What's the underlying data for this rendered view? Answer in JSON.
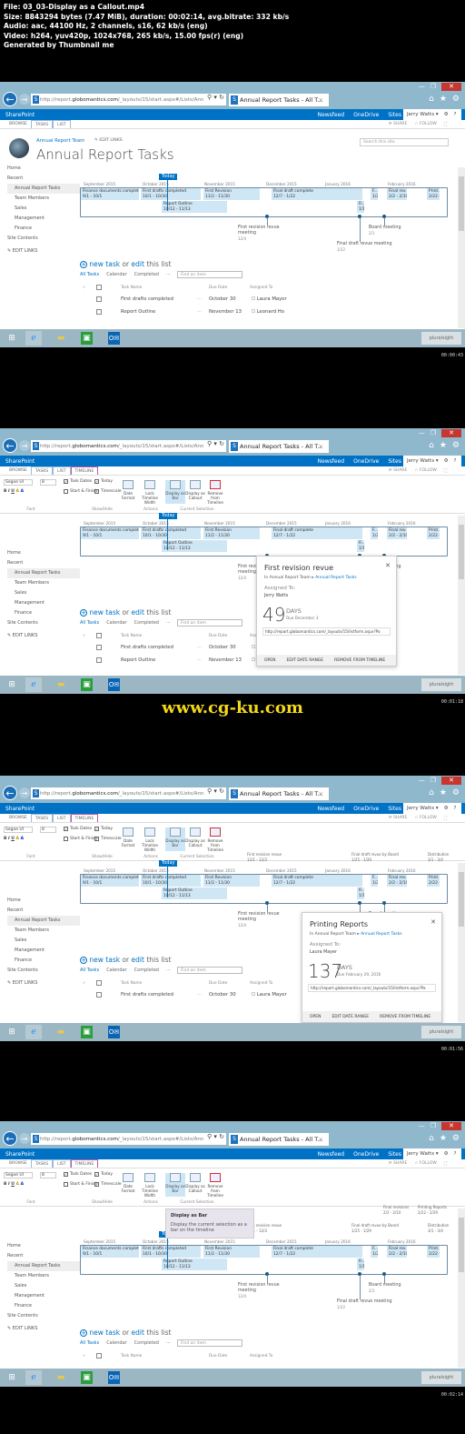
{
  "header": {
    "file": "File: 03_03-Display as a Callout.mp4",
    "size": "Size: 8843294 bytes (7.47 MiB), duration: 00:02:14, avg.bitrate: 332 kb/s",
    "audio": "Audio: aac, 44100 Hz, 2 channels, s16, 62 kb/s (eng)",
    "video": "Video: h264, yuv420p, 1024x768, 265 kb/s, 15.00 fps(r) (eng)",
    "generated": "Generated by Thumbnail me"
  },
  "watermark": "www.cg-ku.com",
  "timestamps": [
    "00:00:43",
    "00:01:18",
    "00:01:56",
    "00:02:14"
  ],
  "browser": {
    "url_prefix": "http://report.",
    "url_domain": "globomantics.com",
    "url_suffix": "/_layouts/15/start.aspx#/Lists/Ann",
    "tab_title": "Annual Report Tasks - All T...",
    "addr_tools": "⚲ ▾ ↻"
  },
  "suite": {
    "brand": "SharePoint",
    "links": [
      "Newsfeed",
      "OneDrive",
      "Sites"
    ],
    "user": "Jerry Watts ▾",
    "gear": "⚙",
    "help": "?"
  },
  "ribbon_tabs": [
    "BROWSE",
    "TASKS",
    "LIST",
    "TIMELINE"
  ],
  "share": {
    "share": "SHARE",
    "follow": "FOLLOW"
  },
  "ribbon": {
    "font_name": "Segoe UI",
    "font_size": "8",
    "font_group": "Font",
    "task_dates": "Task Dates",
    "today": "Today",
    "start_finish": "Start & Finish",
    "timescale": "Timescale",
    "date_format": "Date Format",
    "showhide_group": "Show/Hide",
    "lock_width": "Lock Timeline Width",
    "actions_group": "Actions",
    "display_bar": "Display as Bar",
    "display_callout": "Display as Callout",
    "remove": "Remove from Timeline",
    "selection_group": "Current Selection"
  },
  "site": {
    "team": "Annual Report Team",
    "edit_links": "EDIT LINKS",
    "title": "Annual Report Tasks",
    "search_placeholder": "Search this site"
  },
  "leftnav": {
    "home": "Home",
    "recent": "Recent",
    "items": [
      "Annual Report Tasks",
      "Team Members",
      "Sales",
      "Management",
      "Finance"
    ],
    "site_contents": "Site Contents",
    "edit_links": "EDIT LINKS"
  },
  "timeline": {
    "today_label": "Today",
    "months": [
      "September 2015",
      "October 2015",
      "November 2015",
      "December 2015",
      "January 2016",
      "February 2016"
    ],
    "bars": [
      {
        "name": "Finance documents completed",
        "dates": "9/1 - 10/1"
      },
      {
        "name": "First drafts completed",
        "dates": "10/1 - 10/30"
      },
      {
        "name": "First Revision",
        "dates": "11/2 - 11/30"
      },
      {
        "name": "Final draft complete",
        "dates": "12/7 - 1/22"
      },
      {
        "name": "Report Outline",
        "dates": "10/12 - 11/13"
      },
      {
        "name": "Final rev...",
        "dates": "2/2 - 2/10"
      },
      {
        "name": "Print...",
        "dates": "2/22 -"
      },
      {
        "name": "F...",
        "dates": "1/2"
      },
      {
        "name": "Fi...",
        "dates": "1/1"
      }
    ],
    "milestones": [
      {
        "name": "First revision revue meeting",
        "date": "12/4"
      },
      {
        "name": "Final draft revue meeting",
        "date": "1/22"
      },
      {
        "name": "Board meeting",
        "date": "2/1"
      }
    ],
    "callouts": [
      {
        "name": "First revision revue",
        "dates": "12/1 - 12/3"
      },
      {
        "name": "Final draft revue by Board",
        "dates": "1/25 - 1/29"
      },
      {
        "name": "Distribution",
        "dates": "3/1 - 3/4"
      },
      {
        "name": "Final revisions",
        "dates": "2/2 - 2/10"
      },
      {
        "name": "Printing Reports",
        "dates": "2/22 - 2/29"
      }
    ]
  },
  "list": {
    "new_task": "new task",
    "or": "or",
    "edit": "edit",
    "this_list": "this list",
    "views": [
      "All Tasks",
      "Calendar",
      "Completed",
      "···"
    ],
    "find_placeholder": "Find an item",
    "columns": [
      "Task Name",
      "Due Date",
      "Assigned To"
    ],
    "rows": [
      {
        "task": "First drafts completed",
        "due": "October 30",
        "assigned": "Laura Mayer"
      },
      {
        "task": "Report Outline",
        "due": "November 13",
        "assigned": "Leonard Ho"
      }
    ]
  },
  "callout1": {
    "title": "First revision revue",
    "crumb_site": "In Annual Report Team",
    "crumb_list": "Annual Report Tasks",
    "assigned_label": "Assigned To:",
    "assigned": "Jerry Watts",
    "days_num": "49",
    "days_label": "DAYS",
    "due": "Due December 3",
    "url": "http://report.globomantics.com/_layouts/15/listform.aspx?Pa",
    "actions": [
      "OPEN",
      "EDIT DATE RANGE",
      "REMOVE FROM TIMELINE"
    ]
  },
  "callout2": {
    "title": "Printing Reports",
    "crumb_site": "In Annual Report Team",
    "crumb_list": "Annual Report Tasks",
    "assigned_label": "Assigned To:",
    "assigned": "Laura Mayer",
    "days_num": "137",
    "days_label": "DAYS",
    "due": "Due February 29, 2016",
    "url": "http://report.globomantics.com/_layouts/15/listform.aspx?Pa",
    "actions": [
      "OPEN",
      "EDIT DATE RANGE",
      "REMOVE FROM TIMELINE"
    ]
  },
  "tooltip": {
    "title": "Display as Bar",
    "body": "Display the current selection as a bar on the timeline"
  },
  "taskbar": {
    "brand": "pluralsight"
  }
}
